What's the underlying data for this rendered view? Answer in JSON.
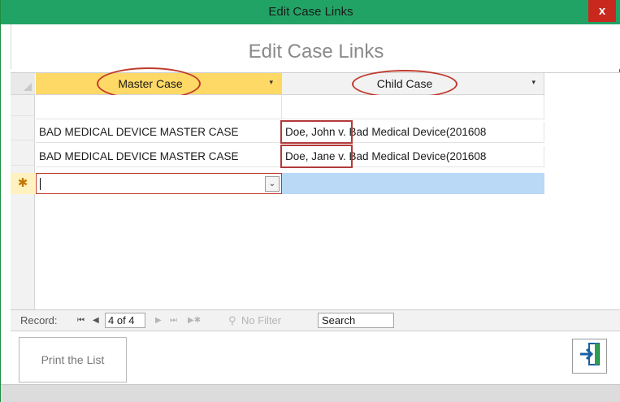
{
  "window": {
    "title": "Edit Case Links",
    "close_label": "x"
  },
  "form": {
    "title": "Edit Case Links"
  },
  "datasheet": {
    "columns": [
      {
        "label": "Master Case",
        "arrow": "▾"
      },
      {
        "label": "Child Case",
        "arrow": "▾"
      }
    ],
    "rows": [
      {
        "master": "",
        "child": ""
      },
      {
        "master": "BAD MEDICAL DEVICE MASTER CASE",
        "child": "Doe, John v. Bad Medical Device(201608"
      },
      {
        "master": "BAD MEDICAL DEVICE MASTER CASE",
        "child": "Doe, Jane v. Bad Medical Device(201608"
      }
    ],
    "new_row_marker": "✱",
    "combo_arrow": "⌄"
  },
  "navigation": {
    "record_label": "Record:",
    "first": "⏮",
    "prev": "◀",
    "current": "4 of 4",
    "next": "▶",
    "last": "⏭",
    "new": "▶✱",
    "filter_icon": "⚲",
    "filter_label": "No Filter",
    "search_placeholder": "Search"
  },
  "footer": {
    "print_label": "Print the List",
    "exit_icon": "exit-icon"
  },
  "colors": {
    "titlebar": "#21a366",
    "header_highlight": "#ffd966",
    "annotation": "#c0392b",
    "selection": "#b9d9f7"
  }
}
